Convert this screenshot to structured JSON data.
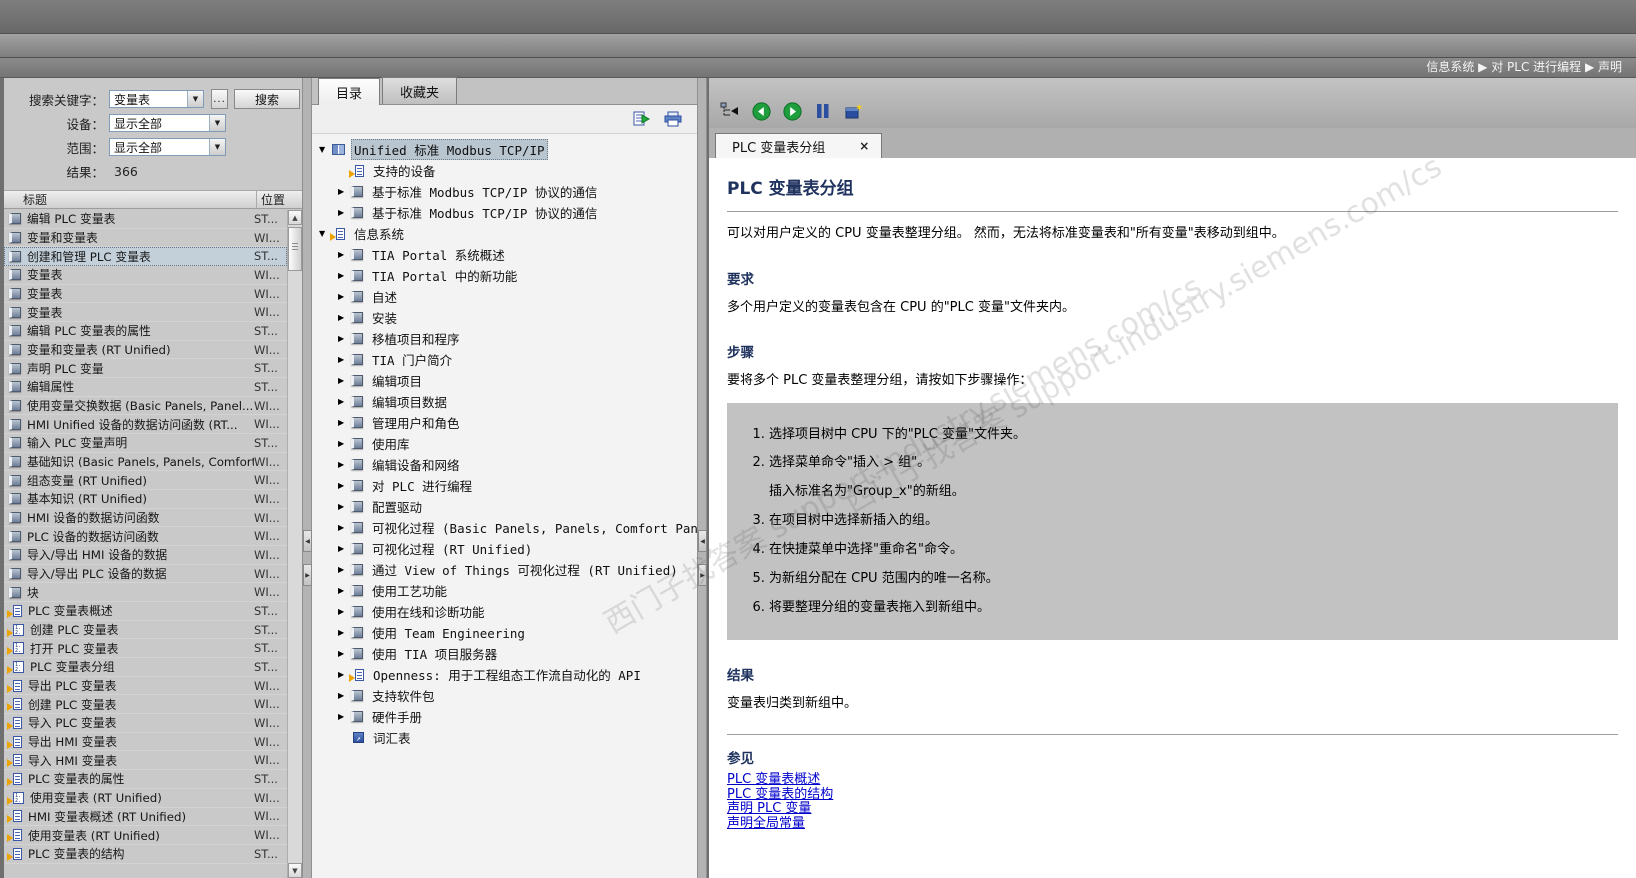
{
  "breadcrumb": "信息系统 ▶ 对 PLC 进行编程 ▶ 声明",
  "watermark": "西门子找答案  support.industry.siemens.com/cs",
  "search_panel": {
    "keyword_label": "搜索关键字：",
    "keyword_value": "变量表",
    "more_button": "...",
    "search_button": "搜索",
    "device_label": "设备：",
    "device_value": "显示全部",
    "scope_label": "范围：",
    "scope_value": "显示全部",
    "results_label": "结果：",
    "results_count": "366",
    "columns": [
      "标题",
      "位置"
    ],
    "rows": [
      {
        "title": "编辑 PLC 变量表",
        "loc": "ST...",
        "icon": "book",
        "selected": false
      },
      {
        "title": "变量和变量表",
        "loc": "WI...",
        "icon": "book",
        "selected": false
      },
      {
        "title": "创建和管理 PLC 变量表",
        "loc": "ST...",
        "icon": "book",
        "selected": true
      },
      {
        "title": "变量表",
        "loc": "WI...",
        "icon": "book",
        "selected": false
      },
      {
        "title": "变量表",
        "loc": "WI...",
        "icon": "book",
        "selected": false
      },
      {
        "title": "变量表",
        "loc": "WI...",
        "icon": "book",
        "selected": false
      },
      {
        "title": "编辑 PLC 变量表的属性",
        "loc": "ST...",
        "icon": "book",
        "selected": false
      },
      {
        "title": "变量和变量表 (RT Unified)",
        "loc": "WI...",
        "icon": "book",
        "selected": false
      },
      {
        "title": "声明 PLC 变量",
        "loc": "ST...",
        "icon": "book",
        "selected": false
      },
      {
        "title": "编辑属性",
        "loc": "ST...",
        "icon": "book",
        "selected": false
      },
      {
        "title": "使用变量交换数据 (Basic Panels, Panel...",
        "loc": "WI...",
        "icon": "book",
        "selected": false
      },
      {
        "title": "HMI Unified 设备的数据访问函数 (RT...",
        "loc": "WI...",
        "icon": "book",
        "selected": false
      },
      {
        "title": "输入 PLC 变量声明",
        "loc": "ST...",
        "icon": "book",
        "selected": false
      },
      {
        "title": "基础知识 (Basic Panels, Panels, Comfort...",
        "loc": "WI...",
        "icon": "book",
        "selected": false
      },
      {
        "title": "组态变量 (RT Unified)",
        "loc": "WI...",
        "icon": "book",
        "selected": false
      },
      {
        "title": "基本知识 (RT Unified)",
        "loc": "WI...",
        "icon": "book",
        "selected": false
      },
      {
        "title": "HMI 设备的数据访问函数",
        "loc": "WI...",
        "icon": "book",
        "selected": false
      },
      {
        "title": "PLC 设备的数据访问函数",
        "loc": "WI...",
        "icon": "book",
        "selected": false
      },
      {
        "title": "导入/导出 HMI 设备的数据",
        "loc": "WI...",
        "icon": "book",
        "selected": false
      },
      {
        "title": "导入/导出 PLC 设备的数据",
        "loc": "WI...",
        "icon": "book",
        "selected": false
      },
      {
        "title": "块",
        "loc": "WI...",
        "icon": "book",
        "selected": false
      },
      {
        "title": "PLC 变量表概述",
        "loc": "ST...",
        "icon": "page",
        "selected": false
      },
      {
        "title": "创建 PLC 变量表",
        "loc": "ST...",
        "icon": "steps",
        "selected": false
      },
      {
        "title": "打开 PLC 变量表",
        "loc": "ST...",
        "icon": "steps",
        "selected": false
      },
      {
        "title": "PLC 变量表分组",
        "loc": "ST...",
        "icon": "steps",
        "selected": false
      },
      {
        "title": "导出 PLC 变量表",
        "loc": "WI...",
        "icon": "page",
        "selected": false
      },
      {
        "title": "创建 PLC 变量表",
        "loc": "WI...",
        "icon": "page",
        "selected": false
      },
      {
        "title": "导入 PLC 变量表",
        "loc": "WI...",
        "icon": "page",
        "selected": false
      },
      {
        "title": "导出 HMI 变量表",
        "loc": "WI...",
        "icon": "page",
        "selected": false
      },
      {
        "title": "导入 HMI 变量表",
        "loc": "WI...",
        "icon": "page",
        "selected": false
      },
      {
        "title": "PLC 变量表的属性",
        "loc": "ST...",
        "icon": "page",
        "selected": false
      },
      {
        "title": "使用变量表 (RT Unified)",
        "loc": "WI...",
        "icon": "steps",
        "selected": false
      },
      {
        "title": "HMI 变量表概述 (RT Unified)",
        "loc": "WI...",
        "icon": "page",
        "selected": false
      },
      {
        "title": "使用变量表 (RT Unified)",
        "loc": "WI...",
        "icon": "page",
        "selected": false
      },
      {
        "title": "PLC 变量表的结构",
        "loc": "ST...",
        "icon": "page",
        "selected": false
      }
    ]
  },
  "toc_panel": {
    "tabs": [
      {
        "label": "目录"
      },
      {
        "label": "收藏夹"
      }
    ],
    "toolbar_icons": [
      "sync-toc-icon",
      "print-icon"
    ],
    "tree": [
      {
        "label": "Unified 标准 Modbus TCP/IP",
        "level": 0,
        "state": "expanded",
        "icon": "bookopen",
        "selected": true
      },
      {
        "label": "支持的设备",
        "level": 1,
        "state": "leaf",
        "icon": "page",
        "selected": false
      },
      {
        "label": "基于标准 Modbus TCP/IP 协议的通信",
        "level": 1,
        "state": "collapsed",
        "icon": "book",
        "selected": false
      },
      {
        "label": "基于标准 Modbus TCP/IP 协议的通信",
        "level": 1,
        "state": "collapsed",
        "icon": "book",
        "selected": false
      },
      {
        "label": "信息系统",
        "level": 0,
        "state": "expanded",
        "icon": "page",
        "selected": false
      },
      {
        "label": "TIA Portal 系统概述",
        "level": 1,
        "state": "collapsed",
        "icon": "book",
        "selected": false
      },
      {
        "label": "TIA Portal 中的新功能",
        "level": 1,
        "state": "collapsed",
        "icon": "book",
        "selected": false
      },
      {
        "label": "自述",
        "level": 1,
        "state": "collapsed",
        "icon": "book",
        "selected": false
      },
      {
        "label": "安装",
        "level": 1,
        "state": "collapsed",
        "icon": "book",
        "selected": false
      },
      {
        "label": "移植项目和程序",
        "level": 1,
        "state": "collapsed",
        "icon": "book",
        "selected": false
      },
      {
        "label": "TIA 门户简介",
        "level": 1,
        "state": "collapsed",
        "icon": "book",
        "selected": false
      },
      {
        "label": "编辑项目",
        "level": 1,
        "state": "collapsed",
        "icon": "book",
        "selected": false
      },
      {
        "label": "编辑项目数据",
        "level": 1,
        "state": "collapsed",
        "icon": "book",
        "selected": false
      },
      {
        "label": "管理用户和角色",
        "level": 1,
        "state": "collapsed",
        "icon": "book",
        "selected": false
      },
      {
        "label": "使用库",
        "level": 1,
        "state": "collapsed",
        "icon": "book",
        "selected": false
      },
      {
        "label": "编辑设备和网络",
        "level": 1,
        "state": "collapsed",
        "icon": "book",
        "selected": false
      },
      {
        "label": "对 PLC 进行编程",
        "level": 1,
        "state": "collapsed",
        "icon": "book",
        "selected": false
      },
      {
        "label": "配置驱动",
        "level": 1,
        "state": "collapsed",
        "icon": "book",
        "selected": false
      },
      {
        "label": "可视化过程 (Basic Panels, Panels, Comfort Panels, RT Adva...",
        "level": 1,
        "state": "collapsed",
        "icon": "book",
        "selected": false
      },
      {
        "label": "可视化过程 (RT Unified)",
        "level": 1,
        "state": "collapsed",
        "icon": "book",
        "selected": false
      },
      {
        "label": "通过 View of Things 可视化过程 (RT Unified)",
        "level": 1,
        "state": "collapsed",
        "icon": "book",
        "selected": false
      },
      {
        "label": "使用工艺功能",
        "level": 1,
        "state": "collapsed",
        "icon": "book",
        "selected": false
      },
      {
        "label": "使用在线和诊断功能",
        "level": 1,
        "state": "collapsed",
        "icon": "book",
        "selected": false
      },
      {
        "label": "使用 Team Engineering",
        "level": 1,
        "state": "collapsed",
        "icon": "book",
        "selected": false
      },
      {
        "label": "使用 TIA 项目服务器",
        "level": 1,
        "state": "collapsed",
        "icon": "book",
        "selected": false
      },
      {
        "label": "Openness: 用于工程组态工作流自动化的 API",
        "level": 1,
        "state": "collapsed",
        "icon": "page",
        "selected": false
      },
      {
        "label": "支持软件包",
        "level": 1,
        "state": "collapsed",
        "icon": "book",
        "selected": false
      },
      {
        "label": "硬件手册",
        "level": 1,
        "state": "collapsed",
        "icon": "book",
        "selected": false
      },
      {
        "label": "词汇表",
        "level": 1,
        "state": "leaf",
        "icon": "glossary",
        "selected": false
      }
    ]
  },
  "content_panel": {
    "toolbar_icons": [
      "locate-in-toc-icon",
      "back-icon",
      "forward-icon",
      "bookmarks-icon",
      "add-favorite-icon"
    ],
    "tab_label": "PLC 变量表分组",
    "tab_close": "×",
    "title": "PLC 变量表分组",
    "intro": "可以对用户定义的 CPU 变量表整理分组。 然而，无法将标准变量表和\"所有变量\"表移动到组中。",
    "requirements": {
      "heading": "要求",
      "text": "多个用户定义的变量表包含在 CPU 的\"PLC 变量\"文件夹内。"
    },
    "steps": {
      "heading": "步骤",
      "lead": "要将多个 PLC 变量表整理分组，请按如下步骤操作：",
      "items": [
        {
          "text": "选择项目树中 CPU 下的\"PLC 变量\"文件夹。"
        },
        {
          "text": "选择菜单命令\"插入 > 组\"。",
          "sub": "插入标准名为\"Group_x\"的新组。"
        },
        {
          "text": "在项目树中选择新插入的组。"
        },
        {
          "text": "在快捷菜单中选择\"重命名\"命令。"
        },
        {
          "text": "为新组分配在 CPU 范围内的唯一名称。"
        },
        {
          "text": "将要整理分组的变量表拖入到新组中。"
        }
      ]
    },
    "result": {
      "heading": "结果",
      "text": "变量表归类到新组中。"
    },
    "see_also": {
      "heading": "参见",
      "links": [
        "PLC 变量表概述",
        "PLC 变量表的结构",
        "声明 PLC 变量",
        "声明全局常量"
      ]
    }
  }
}
